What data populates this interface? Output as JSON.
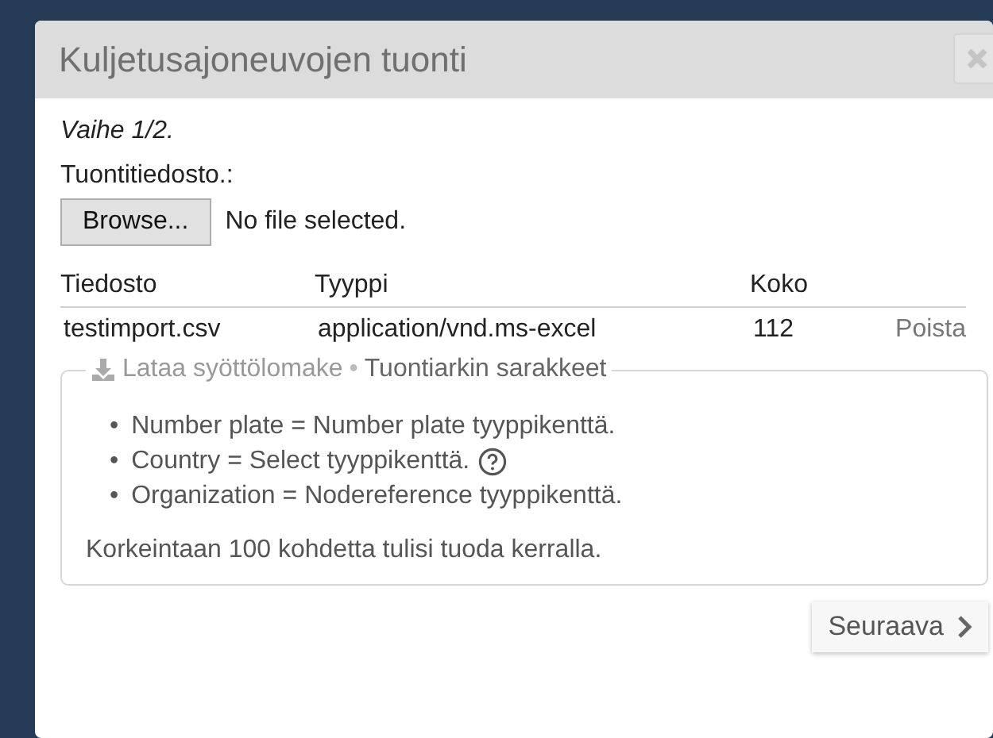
{
  "dialog": {
    "title": "Kuljetusajoneuvojen tuonti",
    "step": "Vaihe 1/2.",
    "file_label": "Tuontitiedosto.:",
    "browse_button": "Browse...",
    "file_status": "No file selected.",
    "table": {
      "columns": [
        "Tiedosto",
        "Tyyppi",
        "Koko"
      ],
      "rows": [
        {
          "cells": [
            "testimport.csv",
            "application/vnd.ms-excel",
            "112"
          ],
          "action": "Poista"
        }
      ]
    },
    "columns_box": {
      "download_link": "Lataa syöttölomake",
      "separator": "•",
      "title": "Tuontiarkin sarakkeet",
      "items": [
        {
          "bullet": "•",
          "text": "Number plate = Number plate tyyppikenttä.",
          "help": false
        },
        {
          "bullet": "•",
          "text": "Country = Select tyyppikenttä.",
          "help": true
        },
        {
          "bullet": "•",
          "text": "Organization = Nodereference tyyppikenttä.",
          "help": false
        }
      ],
      "note": "Korkeintaan 100 kohdetta tulisi tuoda kerralla."
    },
    "next_button": "Seuraava"
  }
}
